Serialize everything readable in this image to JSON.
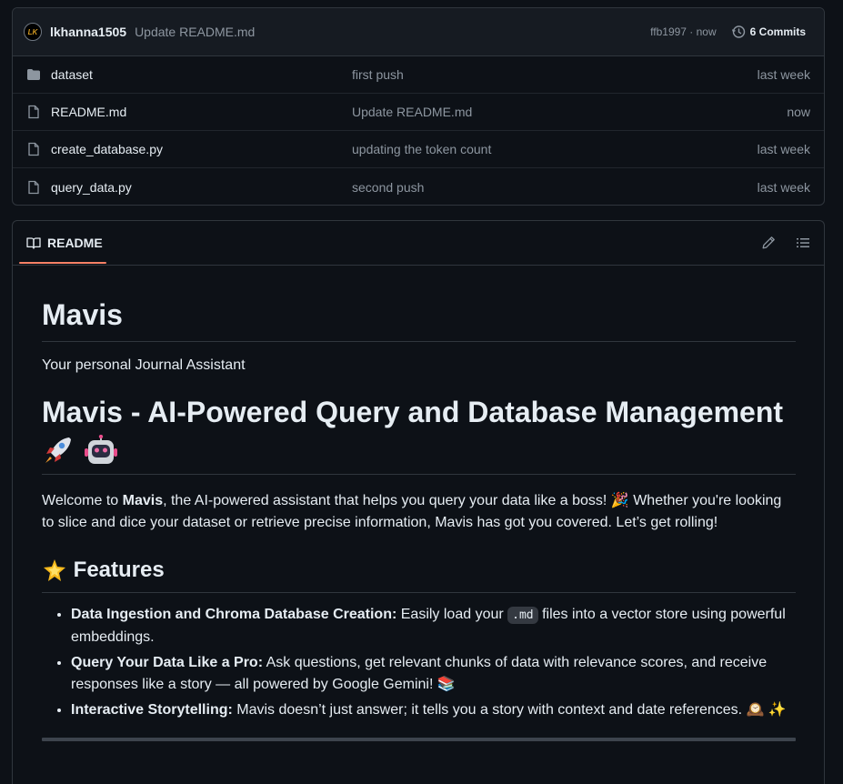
{
  "commit": {
    "avatar_text": "LK",
    "author": "lkhanna1505",
    "message": "Update README.md",
    "hash_time": "ffb1997 · now",
    "commits_label": "6 Commits"
  },
  "files": [
    {
      "name": "dataset",
      "type": "folder",
      "message": "first push",
      "date": "last week"
    },
    {
      "name": "README.md",
      "type": "file",
      "message": "Update README.md",
      "date": "now"
    },
    {
      "name": "create_database.py",
      "type": "file",
      "message": "updating the token count",
      "date": "last week"
    },
    {
      "name": "query_data.py",
      "type": "file",
      "message": "second push",
      "date": "last week"
    }
  ],
  "readme": {
    "tab_label": "README",
    "title": "Mavis",
    "tagline": "Your personal Journal Assistant",
    "heading": "Mavis - AI-Powered Query and Database Management",
    "intro_prefix": "Welcome to ",
    "intro_bold": "Mavis",
    "intro_rest": ", the AI-powered assistant that helps you query your data like a boss! 🎉 Whether you're looking to slice and dice your dataset or retrieve precise information, Mavis has got you covered. Let’s get rolling!",
    "features_heading": "Features",
    "features": [
      {
        "bold": "Data Ingestion and Chroma Database Creation:",
        "pre": " Easily load your ",
        "code": ".md",
        "post": " files into a vector store using powerful embeddings."
      },
      {
        "bold": "Query Your Data Like a Pro:",
        "pre": " Ask questions, get relevant chunks of data with relevance scores, and receive responses like a story — all powered by Google Gemini! 📚",
        "code": "",
        "post": ""
      },
      {
        "bold": "Interactive Storytelling:",
        "pre": " Mavis doesn’t just answer; it tells you a story with context and date references. 🕰️ ✨",
        "code": "",
        "post": ""
      }
    ]
  },
  "colors": {
    "accent_tab": "#f78166",
    "bg": "#0d1117",
    "muted": "#8d96a0"
  }
}
